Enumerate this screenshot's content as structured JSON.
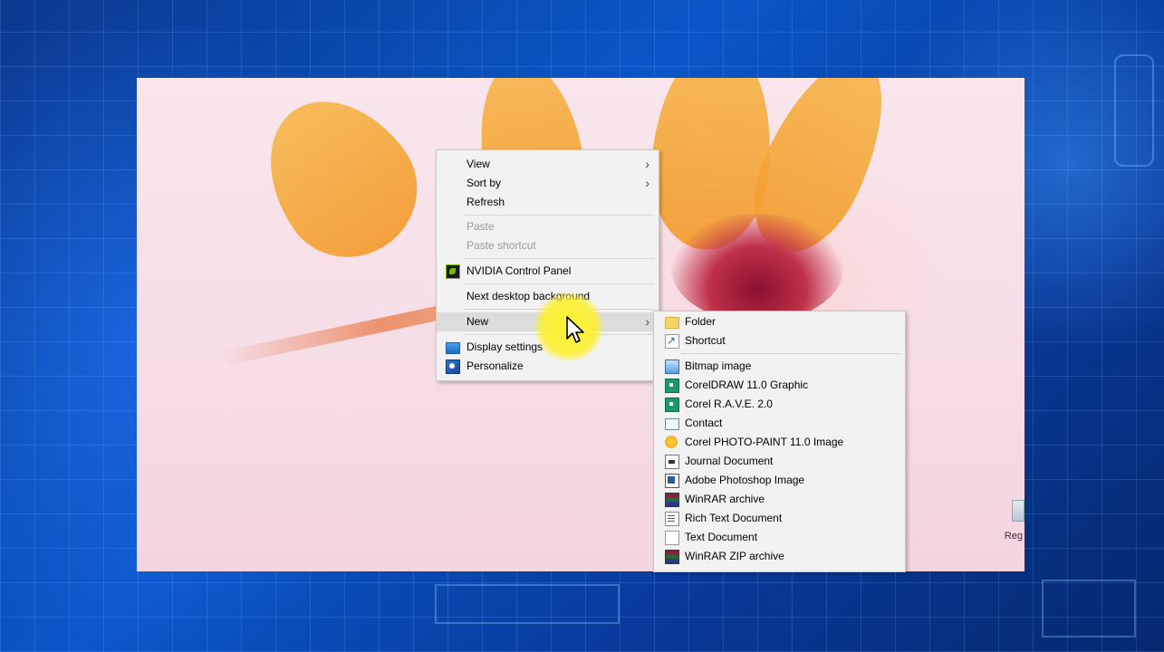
{
  "context_menu": {
    "items": [
      {
        "label": "View",
        "has_submenu": true,
        "disabled": false
      },
      {
        "label": "Sort by",
        "has_submenu": true,
        "disabled": false
      },
      {
        "label": "Refresh",
        "has_submenu": false,
        "disabled": false
      },
      {
        "label": "Paste",
        "has_submenu": false,
        "disabled": true
      },
      {
        "label": "Paste shortcut",
        "has_submenu": false,
        "disabled": true
      },
      {
        "label": "NVIDIA Control Panel",
        "icon": "nvidia-icon",
        "disabled": false
      },
      {
        "label": "Next desktop background",
        "disabled": false
      },
      {
        "label": "New",
        "has_submenu": true,
        "highlighted": true,
        "disabled": false
      },
      {
        "label": "Display settings",
        "icon": "display-icon",
        "disabled": false
      },
      {
        "label": "Personalize",
        "icon": "personalize-icon",
        "disabled": false
      }
    ]
  },
  "new_submenu": {
    "items": [
      {
        "label": "Folder",
        "icon": "folder-icon"
      },
      {
        "label": "Shortcut",
        "icon": "shortcut-icon"
      },
      {
        "label": "Bitmap image",
        "icon": "bitmap-icon"
      },
      {
        "label": "CorelDRAW 11.0 Graphic",
        "icon": "coreldraw-icon"
      },
      {
        "label": "Corel R.A.V.E. 2.0",
        "icon": "corel-rave-icon"
      },
      {
        "label": "Contact",
        "icon": "contact-icon"
      },
      {
        "label": "Corel PHOTO-PAINT 11.0 Image",
        "icon": "photo-paint-icon"
      },
      {
        "label": "Journal Document",
        "icon": "journal-icon"
      },
      {
        "label": "Adobe Photoshop Image",
        "icon": "photoshop-icon"
      },
      {
        "label": "WinRAR archive",
        "icon": "winrar-icon"
      },
      {
        "label": "Rich Text Document",
        "icon": "rtf-icon"
      },
      {
        "label": "Text Document",
        "icon": "text-document-icon"
      },
      {
        "label": "WinRAR ZIP archive",
        "icon": "winrar-zip-icon"
      }
    ]
  },
  "desktop": {
    "icon_label": "Reg"
  }
}
